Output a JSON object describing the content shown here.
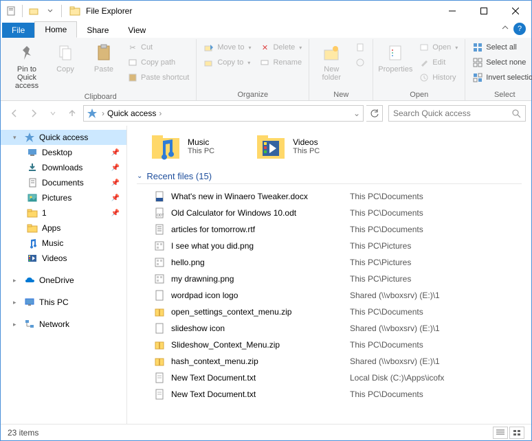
{
  "window": {
    "title": "File Explorer"
  },
  "tabs": {
    "file": "File",
    "home": "Home",
    "share": "Share",
    "view": "View"
  },
  "ribbon": {
    "clipboard": {
      "label": "Clipboard",
      "pin": "Pin to Quick access",
      "copy": "Copy",
      "paste": "Paste",
      "cut": "Cut",
      "copy_path": "Copy path",
      "paste_shortcut": "Paste shortcut"
    },
    "organize": {
      "label": "Organize",
      "move_to": "Move to",
      "copy_to": "Copy to",
      "delete": "Delete",
      "rename": "Rename"
    },
    "new": {
      "label": "New",
      "new_folder": "New folder"
    },
    "open": {
      "label": "Open",
      "properties": "Properties",
      "open": "Open",
      "edit": "Edit",
      "history": "History"
    },
    "select": {
      "label": "Select",
      "select_all": "Select all",
      "select_none": "Select none",
      "invert": "Invert selection"
    }
  },
  "breadcrumb": {
    "root": "Quick access"
  },
  "search": {
    "placeholder": "Search Quick access"
  },
  "sidebar": {
    "quick_access": "Quick access",
    "items": [
      {
        "label": "Desktop",
        "pinned": true,
        "icon": "desktop"
      },
      {
        "label": "Downloads",
        "pinned": true,
        "icon": "downloads"
      },
      {
        "label": "Documents",
        "pinned": true,
        "icon": "documents"
      },
      {
        "label": "Pictures",
        "pinned": true,
        "icon": "pictures"
      },
      {
        "label": "1",
        "pinned": true,
        "icon": "folder"
      },
      {
        "label": "Apps",
        "pinned": false,
        "icon": "folder"
      },
      {
        "label": "Music",
        "pinned": false,
        "icon": "music"
      },
      {
        "label": "Videos",
        "pinned": false,
        "icon": "videos"
      }
    ],
    "onedrive": "OneDrive",
    "this_pc": "This PC",
    "network": "Network"
  },
  "folders": [
    {
      "name": "Music",
      "loc": "This PC",
      "icon": "music"
    },
    {
      "name": "Videos",
      "loc": "This PC",
      "icon": "videos"
    }
  ],
  "recent": {
    "header": "Recent files (15)",
    "files": [
      {
        "name": "What's new in Winaero Tweaker.docx",
        "loc": "This PC\\Documents",
        "icon": "docx"
      },
      {
        "name": "Old Calculator for Windows 10.odt",
        "loc": "This PC\\Documents",
        "icon": "odt"
      },
      {
        "name": "articles for tomorrow.rtf",
        "loc": "This PC\\Documents",
        "icon": "rtf"
      },
      {
        "name": "I see what you did.png",
        "loc": "This PC\\Pictures",
        "icon": "png"
      },
      {
        "name": "hello.png",
        "loc": "This PC\\Pictures",
        "icon": "png"
      },
      {
        "name": "my drawning.png",
        "loc": "This PC\\Pictures",
        "icon": "png"
      },
      {
        "name": "wordpad icon logo",
        "loc": "Shared (\\\\vboxsrv) (E:)\\1",
        "icon": "file"
      },
      {
        "name": "open_settings_context_menu.zip",
        "loc": "This PC\\Documents",
        "icon": "zip"
      },
      {
        "name": "slideshow icon",
        "loc": "Shared (\\\\vboxsrv) (E:)\\1",
        "icon": "file"
      },
      {
        "name": "Slideshow_Context_Menu.zip",
        "loc": "This PC\\Documents",
        "icon": "zip"
      },
      {
        "name": "hash_context_menu.zip",
        "loc": "Shared (\\\\vboxsrv) (E:)\\1",
        "icon": "zip"
      },
      {
        "name": "New Text Document.txt",
        "loc": "Local Disk (C:)\\Apps\\icofx",
        "icon": "txt"
      },
      {
        "name": "New Text Document.txt",
        "loc": "This PC\\Documents",
        "icon": "txt"
      }
    ]
  },
  "status": {
    "items": "23 items"
  }
}
